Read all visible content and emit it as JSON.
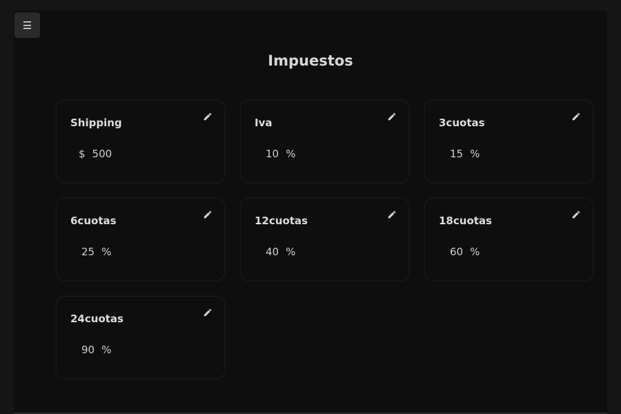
{
  "menu_icon": "☰",
  "title": "Impuestos",
  "taxes": [
    {
      "name": "Shipping",
      "value": "500",
      "prefix": "$",
      "suffix": ""
    },
    {
      "name": "Iva",
      "value": "10",
      "prefix": "",
      "suffix": "%"
    },
    {
      "name": "3cuotas",
      "value": "15",
      "prefix": "",
      "suffix": "%"
    },
    {
      "name": "6cuotas",
      "value": "25",
      "prefix": "",
      "suffix": "%"
    },
    {
      "name": "12cuotas",
      "value": "40",
      "prefix": "",
      "suffix": "%"
    },
    {
      "name": "18cuotas",
      "value": "60",
      "prefix": "",
      "suffix": "%"
    },
    {
      "name": "24cuotas",
      "value": "90",
      "prefix": "",
      "suffix": "%"
    }
  ]
}
